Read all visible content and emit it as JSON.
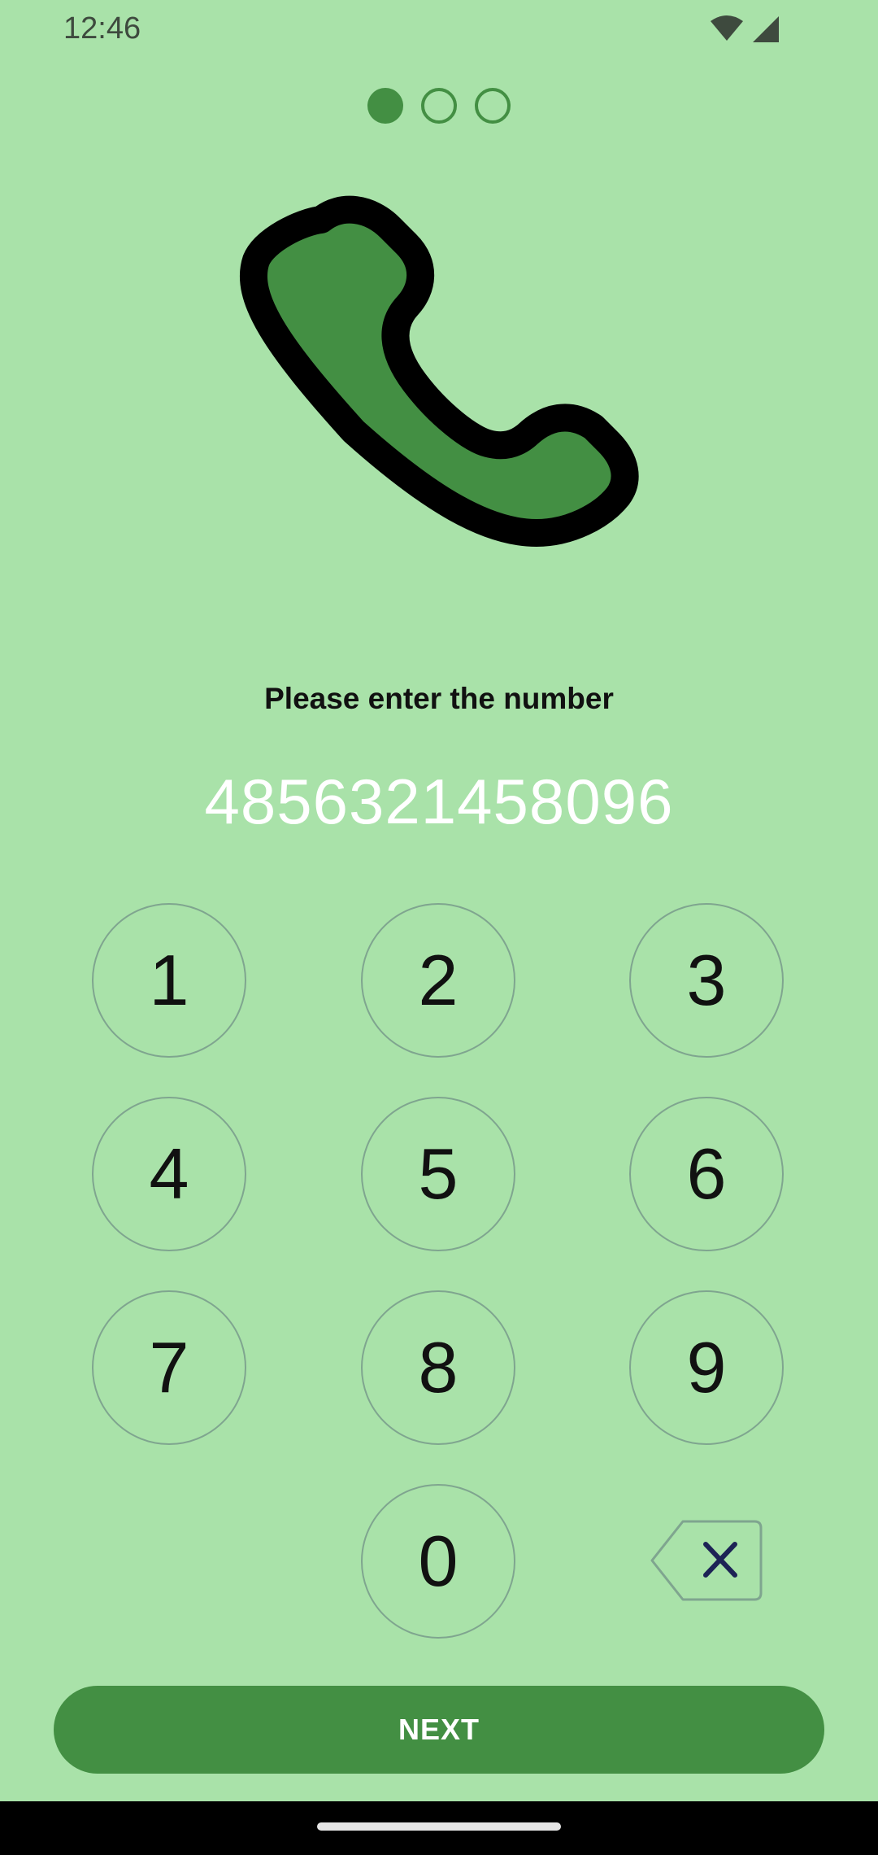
{
  "status_bar": {
    "time": "12:46",
    "icons": [
      "wifi-icon",
      "cellular-signal-icon"
    ]
  },
  "pager": {
    "total": 3,
    "current": 1
  },
  "illustration": {
    "icon": "phone-handset-icon"
  },
  "prompt": "Please enter the number",
  "number": "4856321458096",
  "keypad": {
    "keys": [
      "1",
      "2",
      "3",
      "4",
      "5",
      "6",
      "7",
      "8",
      "9",
      "0"
    ],
    "backspace_icon": "backspace-icon"
  },
  "next_button": {
    "label": "NEXT"
  },
  "colors": {
    "background": "#a9e2a9",
    "accent": "#438f43",
    "number_text": "#ffffff"
  }
}
